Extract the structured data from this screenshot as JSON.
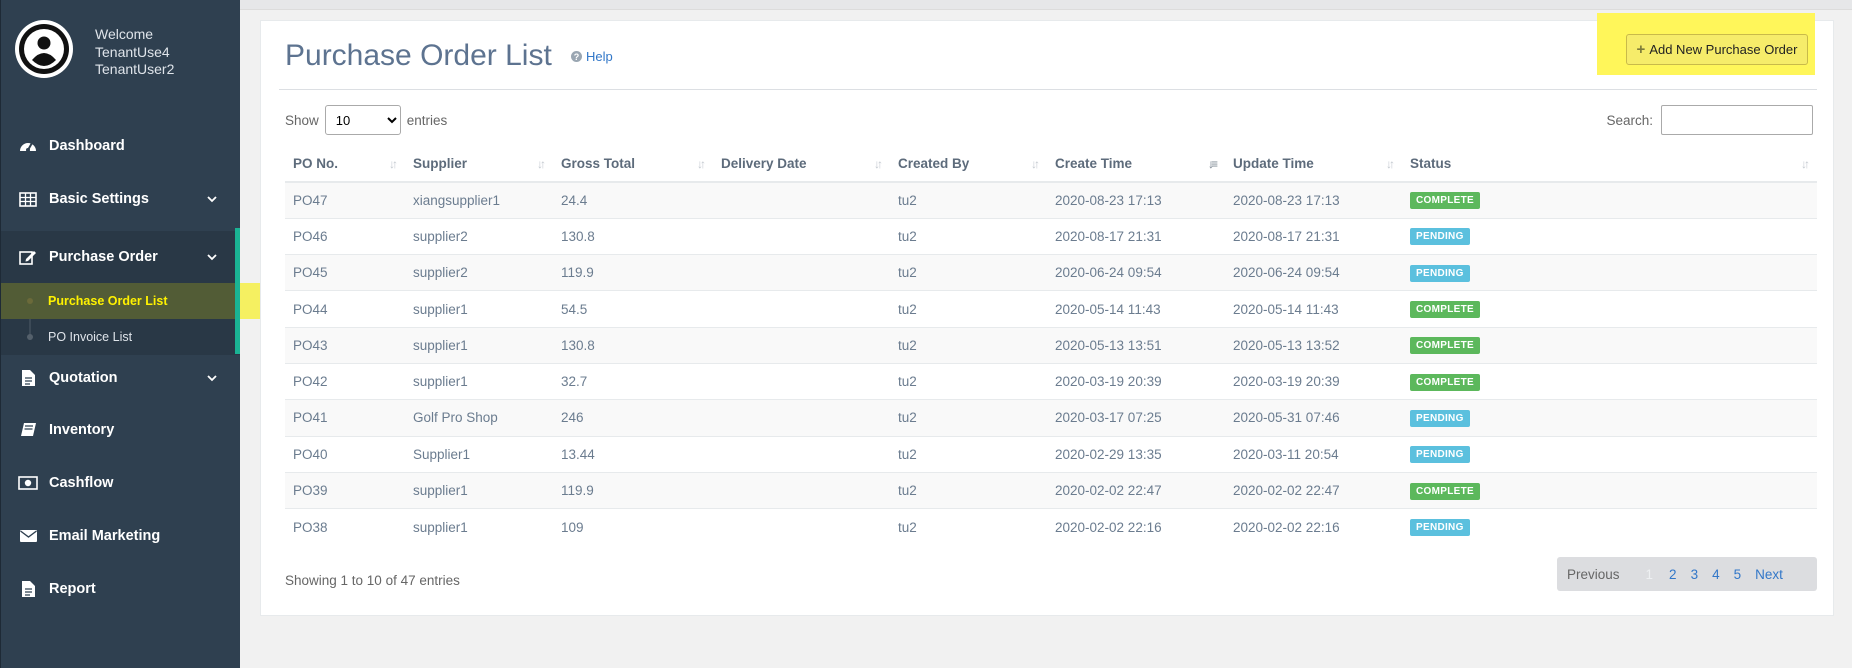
{
  "user": {
    "welcome": "Welcome",
    "name_line1": "TenantUse4",
    "name_line2": "TenantUser2"
  },
  "sidebar": {
    "items": [
      {
        "label": "Dashboard",
        "icon": "dashboard-icon"
      },
      {
        "label": "Basic Settings",
        "icon": "table-icon"
      },
      {
        "label": "Purchase Order",
        "icon": "edit-icon"
      },
      {
        "label": "Quotation",
        "icon": "file-icon"
      },
      {
        "label": "Inventory",
        "icon": "book-icon"
      },
      {
        "label": "Cashflow",
        "icon": "money-icon"
      },
      {
        "label": "Email Marketing",
        "icon": "envelope-icon"
      },
      {
        "label": "Report",
        "icon": "file-icon"
      }
    ],
    "purchase_sub": [
      {
        "label": "Purchase Order List"
      },
      {
        "label": "PO Invoice List"
      }
    ]
  },
  "page": {
    "title": "Purchase Order List",
    "help": "Help",
    "add_button": "Add New Purchase Order"
  },
  "controls": {
    "show": "Show",
    "entries_value": "10",
    "entries": "entries",
    "search": "Search:"
  },
  "table": {
    "headers": [
      "PO No.",
      "Supplier",
      "Gross Total",
      "Delivery Date",
      "Created By",
      "Create Time",
      "Update Time",
      "Status"
    ],
    "rows": [
      [
        "PO47",
        "xiangsupplier1",
        "24.4",
        "",
        "tu2",
        "2020-08-23 17:13",
        "2020-08-23 17:13",
        "COMPLETE"
      ],
      [
        "PO46",
        "supplier2",
        "130.8",
        "",
        "tu2",
        "2020-08-17 21:31",
        "2020-08-17 21:31",
        "PENDING"
      ],
      [
        "PO45",
        "supplier2",
        "119.9",
        "",
        "tu2",
        "2020-06-24 09:54",
        "2020-06-24 09:54",
        "PENDING"
      ],
      [
        "PO44",
        "supplier1",
        "54.5",
        "",
        "tu2",
        "2020-05-14 11:43",
        "2020-05-14 11:43",
        "COMPLETE"
      ],
      [
        "PO43",
        "supplier1",
        "130.8",
        "",
        "tu2",
        "2020-05-13 13:51",
        "2020-05-13 13:52",
        "COMPLETE"
      ],
      [
        "PO42",
        "supplier1",
        "32.7",
        "",
        "tu2",
        "2020-03-19 20:39",
        "2020-03-19 20:39",
        "COMPLETE"
      ],
      [
        "PO41",
        "Golf Pro Shop",
        "246",
        "",
        "tu2",
        "2020-03-17 07:25",
        "2020-05-31 07:46",
        "PENDING"
      ],
      [
        "PO40",
        "Supplier1",
        "13.44",
        "",
        "tu2",
        "2020-02-29 13:35",
        "2020-03-11 20:54",
        "PENDING"
      ],
      [
        "PO39",
        "supplier1",
        "119.9",
        "",
        "tu2",
        "2020-02-02 22:47",
        "2020-02-02 22:47",
        "COMPLETE"
      ],
      [
        "PO38",
        "supplier1",
        "109",
        "",
        "tu2",
        "2020-02-02 22:16",
        "2020-02-02 22:16",
        "PENDING"
      ]
    ]
  },
  "status_colors": {
    "COMPLETE": "#5cb85c",
    "PENDING": "#5bc0de"
  },
  "footer": {
    "info": "Showing 1 to 10 of 47 entries"
  },
  "pagination": {
    "prev": "Previous",
    "pages": [
      "1",
      "2",
      "3",
      "4",
      "5"
    ],
    "next": "Next"
  }
}
